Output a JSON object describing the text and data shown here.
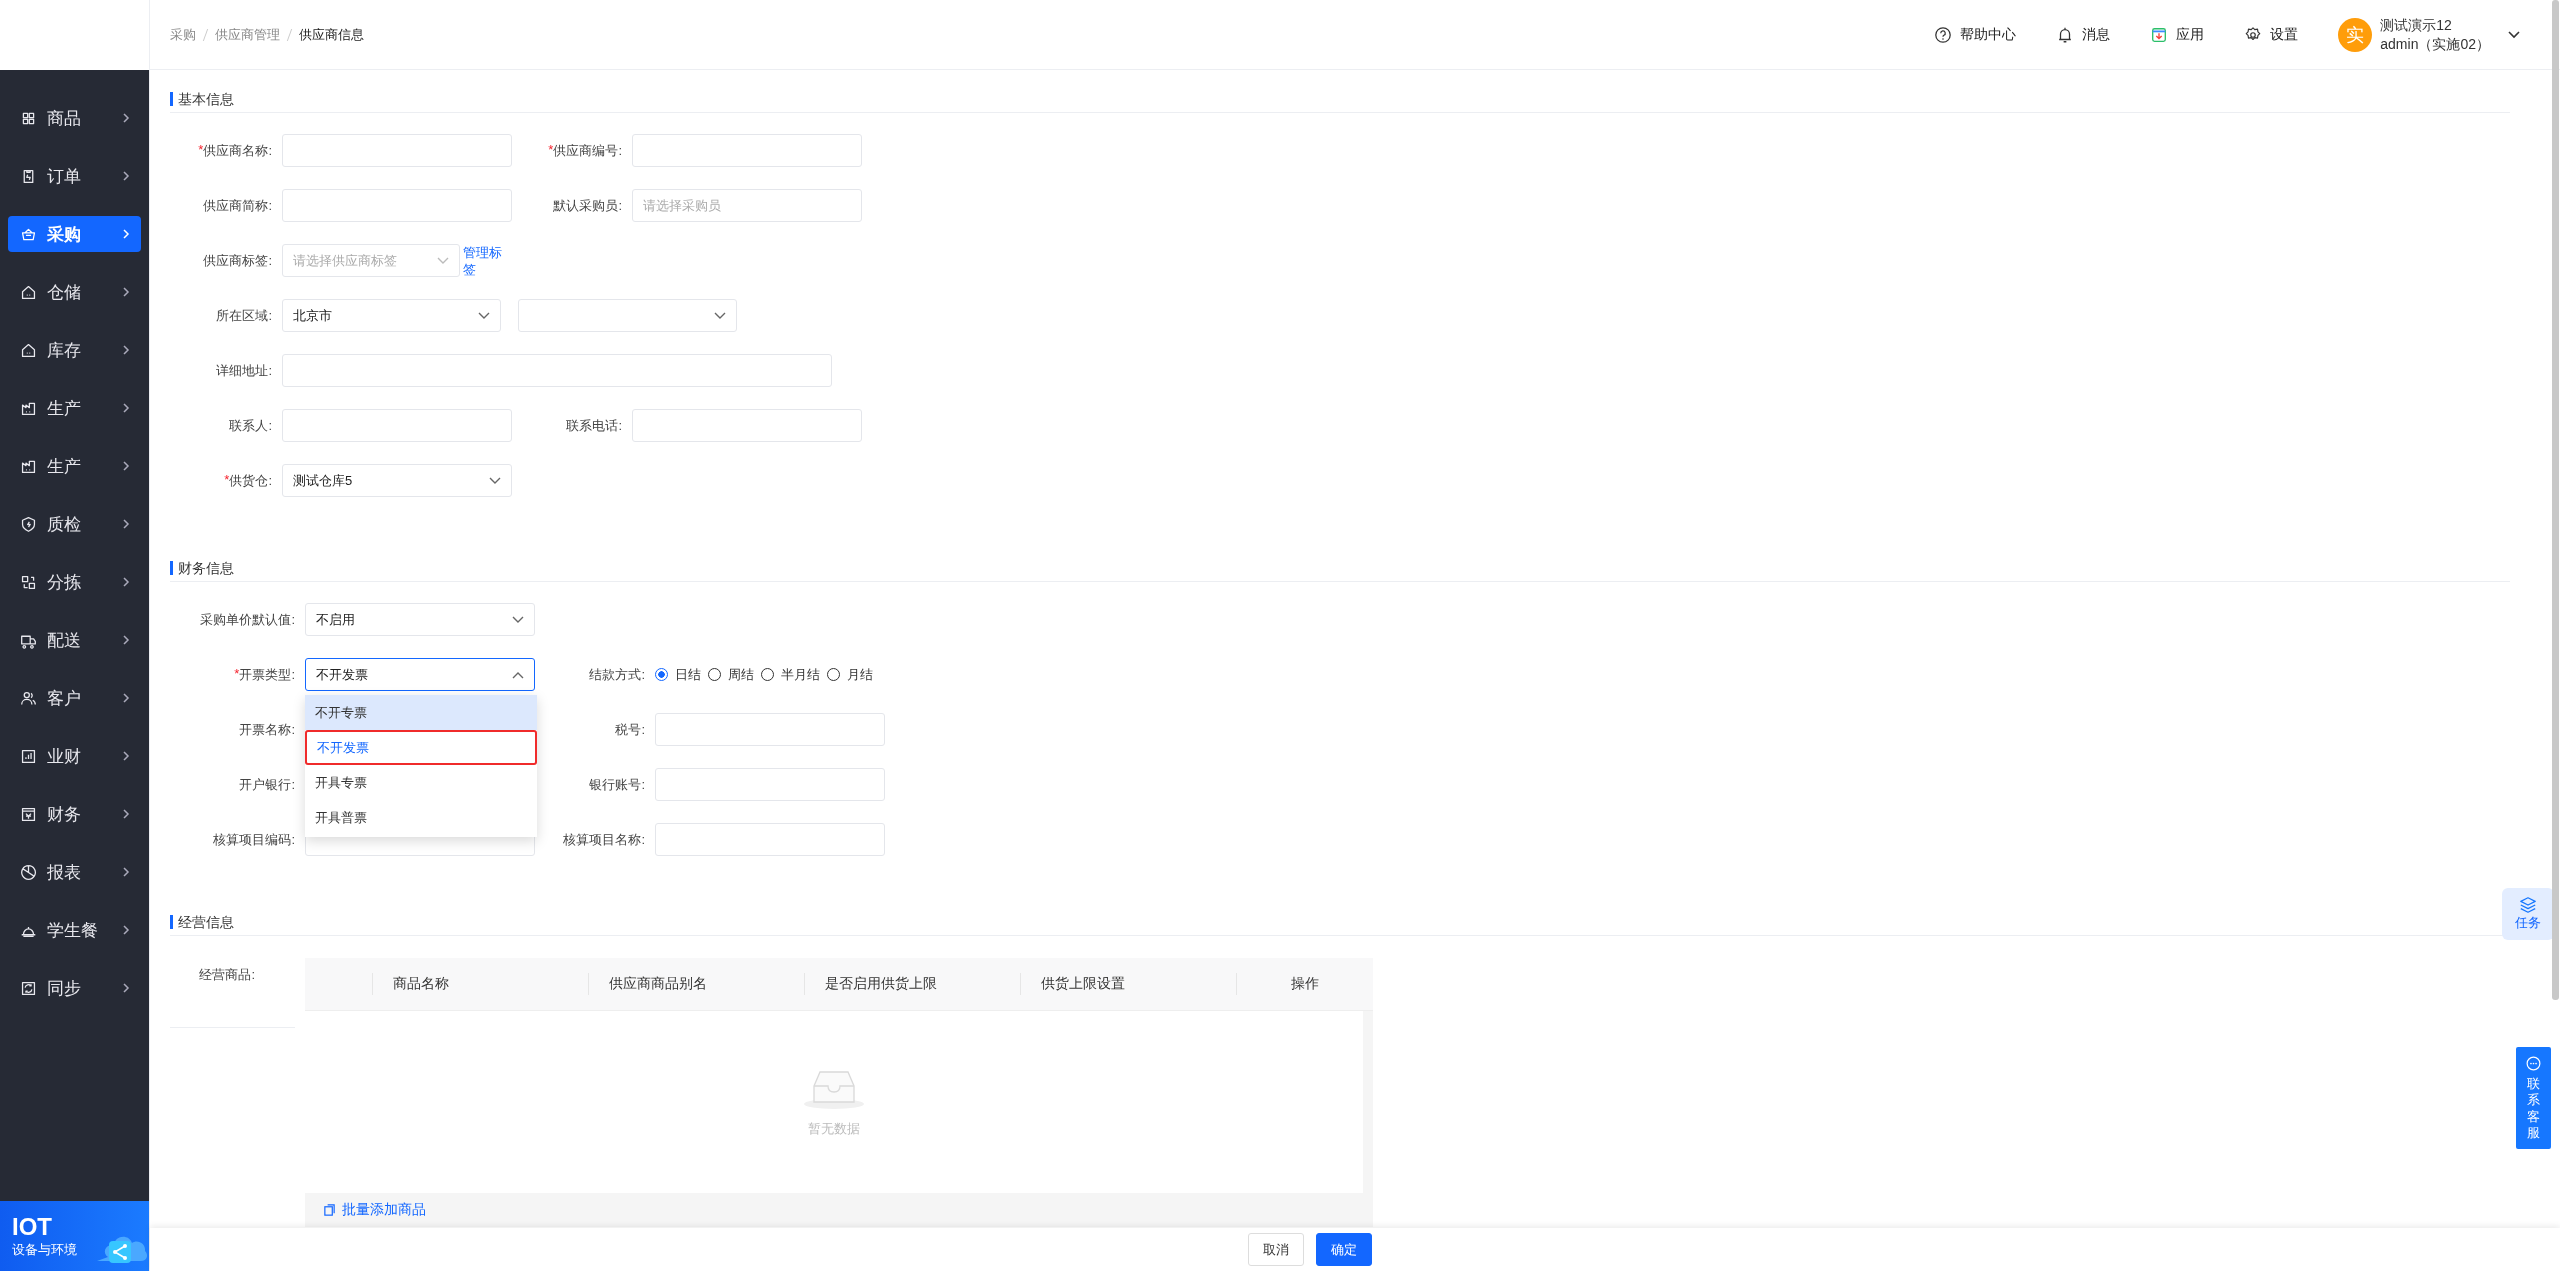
{
  "sidebar": {
    "items": [
      {
        "label": "商品",
        "selected": false
      },
      {
        "label": "订单",
        "selected": false
      },
      {
        "label": "采购",
        "selected": true
      },
      {
        "label": "仓储",
        "selected": false
      },
      {
        "label": "库存",
        "selected": false
      },
      {
        "label": "生产",
        "selected": false
      },
      {
        "label": "生产",
        "selected": false
      },
      {
        "label": "质检",
        "selected": false
      },
      {
        "label": "分拣",
        "selected": false
      },
      {
        "label": "配送",
        "selected": false
      },
      {
        "label": "客户",
        "selected": false
      },
      {
        "label": "业财",
        "selected": false
      },
      {
        "label": "财务",
        "selected": false
      },
      {
        "label": "报表",
        "selected": false
      },
      {
        "label": "学生餐",
        "selected": false
      },
      {
        "label": "同步",
        "selected": false
      }
    ],
    "footer": {
      "title": "IOT",
      "subtitle": "设备与环境"
    }
  },
  "breadcrumb": [
    "采购",
    "供应商管理",
    "供应商信息"
  ],
  "header": {
    "actions": [
      {
        "label": "帮助中心",
        "kind": "help"
      },
      {
        "label": "消息",
        "kind": "bell"
      },
      {
        "label": "应用",
        "kind": "app"
      },
      {
        "label": "设置",
        "kind": "settings"
      }
    ],
    "user": {
      "avatar": "实",
      "name": "测试演示12",
      "role": "admin（实施02）"
    }
  },
  "basic_info": {
    "title": "基本信息",
    "rows": [
      [
        {
          "label": "供应商名称:",
          "required_mark": "*",
          "kind": "input"
        },
        {
          "label": "供应商编号:",
          "required_mark": "*",
          "kind": "input"
        }
      ],
      [
        {
          "label": "供应商简称:",
          "kind": "input"
        },
        {
          "label": "默认采购员:",
          "kind": "input",
          "placeholder": "请选择采购员"
        }
      ],
      [
        {
          "label": "供应商标签:",
          "kind": "tag_select",
          "placeholder": "请选择供应商标签",
          "link": "管理标签"
        }
      ],
      [
        {
          "label": "所在区域:",
          "kind": "select_narrow",
          "value": "北京市"
        },
        {
          "kind": "select_narrow"
        }
      ],
      [
        {
          "label": "详细地址:",
          "kind": "input_wide"
        }
      ],
      [
        {
          "label": "联系人:",
          "kind": "input"
        },
        {
          "label": "联系电话:",
          "kind": "input"
        }
      ],
      [
        {
          "label": "供货仓:",
          "required_mark": "*",
          "kind": "select",
          "value": "测试仓库5"
        }
      ]
    ]
  },
  "finance_info": {
    "title": "财务信息",
    "rows": [
      [
        {
          "label": "采购单价默认值:",
          "kind": "select",
          "value": "不启用"
        }
      ],
      [
        {
          "label": "开票类型:",
          "required_mark": "*",
          "kind": "select_open",
          "value": "不开发票"
        },
        {
          "label": "结款方式:",
          "kind": "radio",
          "options": [
            {
              "label": "日结",
              "selected": true
            },
            {
              "label": "周结",
              "selected": false
            },
            {
              "label": "半月结",
              "selected": false
            },
            {
              "label": "月结",
              "selected": false
            }
          ]
        }
      ],
      [
        {
          "label": "开票名称:",
          "kind": "covered"
        },
        {
          "label": "税号:",
          "kind": "input"
        }
      ],
      [
        {
          "label": "开户银行:",
          "kind": "covered"
        },
        {
          "label": "银行账号:",
          "kind": "input"
        }
      ],
      [
        {
          "label": "核算项目编码:",
          "kind": "input"
        },
        {
          "label": "核算项目名称:",
          "kind": "input"
        }
      ]
    ],
    "invoice_dropdown": [
      {
        "label": "不开专票",
        "highlighted": true,
        "selected": false,
        "outlined": false
      },
      {
        "label": "不开发票",
        "highlighted": false,
        "selected": true,
        "outlined": true
      },
      {
        "label": "开具专票",
        "highlighted": false,
        "selected": false,
        "outlined": false
      },
      {
        "label": "开具普票",
        "highlighted": false,
        "selected": false,
        "outlined": false
      }
    ]
  },
  "business_info": {
    "title": "经营信息",
    "label": "经营商品:",
    "table": {
      "columns": [
        "商品名称",
        "供应商商品别名",
        "是否启用供货上限",
        "供货上限设置",
        "操作"
      ],
      "empty_text": "暂无数据"
    },
    "add_link": "批量添加商品"
  },
  "footer_buttons": [
    {
      "label": "取消",
      "kind": "default"
    },
    {
      "label": "确定",
      "kind": "primary"
    }
  ],
  "floating": {
    "task": "任务",
    "service": "联系客服"
  }
}
